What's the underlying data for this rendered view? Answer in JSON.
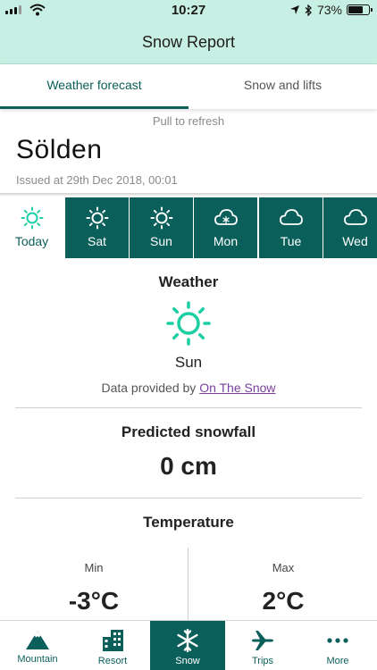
{
  "status_bar": {
    "time": "10:27",
    "battery": "73%",
    "battery_level": 0.73
  },
  "header": {
    "title": "Snow Report"
  },
  "tabs": [
    {
      "label": "Weather forecast",
      "active": true
    },
    {
      "label": "Snow and lifts",
      "active": false
    }
  ],
  "pull_to_refresh": "Pull to refresh",
  "resort": {
    "name": "Sölden",
    "issued": "Issued at 29th Dec 2018, 00:01"
  },
  "days": [
    {
      "label": "Today",
      "icon": "sun-icon",
      "active": true
    },
    {
      "label": "Sat",
      "icon": "sun-icon",
      "active": false
    },
    {
      "label": "Sun",
      "icon": "sun-icon",
      "active": false
    },
    {
      "label": "Mon",
      "icon": "snow-cloud-icon",
      "active": false
    },
    {
      "label": "Tue",
      "icon": "cloud-icon",
      "active": false
    },
    {
      "label": "Wed",
      "icon": "cloud-icon",
      "active": false
    }
  ],
  "weather": {
    "title": "Weather",
    "condition": "Sun",
    "icon": "sun-icon",
    "provider_prefix": "Data provided by",
    "provider_link": "On The Snow"
  },
  "snowfall": {
    "title": "Predicted snowfall",
    "value": "0 cm"
  },
  "temperature": {
    "title": "Temperature",
    "min_label": "Min",
    "min_value": "-3°C",
    "max_label": "Max",
    "max_value": "2°C"
  },
  "bottom_nav": [
    {
      "label": "Mountain",
      "icon": "mountain-icon",
      "active": false
    },
    {
      "label": "Resort",
      "icon": "building-icon",
      "active": false
    },
    {
      "label": "Snow",
      "icon": "snowflake-icon",
      "active": true
    },
    {
      "label": "Trips",
      "icon": "plane-icon",
      "active": false
    },
    {
      "label": "More",
      "icon": "more-dots-icon",
      "active": false
    }
  ],
  "colors": {
    "accent": "#0b5f5a",
    "icon_accent": "#1ccfa3",
    "header_bg": "#c8efe3",
    "link": "#7b3fa0"
  }
}
